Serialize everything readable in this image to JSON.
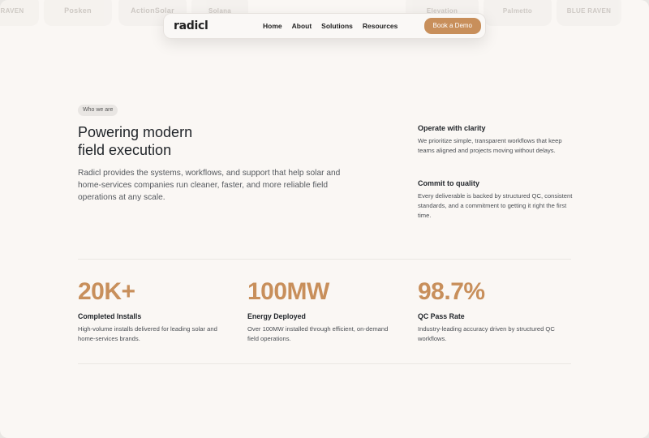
{
  "logo_strip": [
    "RAVEN",
    "Posken",
    "ActionSolar",
    "Solana",
    "Elevation",
    "Palmetto",
    "BLUE RAVEN"
  ],
  "nav": {
    "brand": "radicl",
    "links": [
      "Home",
      "About",
      "Solutions",
      "Resources"
    ],
    "cta": "Book a Demo"
  },
  "hero": {
    "eyebrow": "Who we are",
    "headline_line1": "Powering modern",
    "headline_line2": "field execution",
    "lead": "Radicl provides the systems, workflows, and support that help solar and home-services companies run cleaner, faster, and more reliable field operations at any scale."
  },
  "features": [
    {
      "title": "Operate with clarity",
      "text": "We prioritize simple, transparent workflows that keep teams aligned and projects moving without delays."
    },
    {
      "title": "Commit to quality",
      "text": "Every deliverable is backed by structured QC, consistent standards, and a commitment to getting it right the first time."
    }
  ],
  "stats": [
    {
      "value": "20K+",
      "label": "Completed Installs",
      "desc": "High-volume installs delivered for leading solar and home-services brands."
    },
    {
      "value": "100MW",
      "label": "Energy Deployed",
      "desc": "Over 100MW installed through efficient, on-demand field operations."
    },
    {
      "value": "98.7%",
      "label": "QC Pass Rate",
      "desc": "Industry-leading accuracy driven by structured QC workflows."
    }
  ],
  "colors": {
    "accent": "#c88f5b",
    "background": "#faf7f4",
    "text": "#1f2328"
  }
}
